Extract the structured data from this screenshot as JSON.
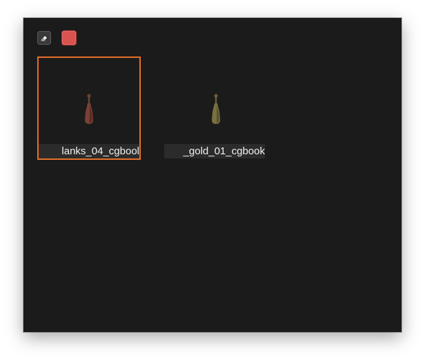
{
  "toolbar": {
    "eraser_icon": "eraser-icon",
    "swatch_color": "#d9534f"
  },
  "assets": [
    {
      "label": "lanks_04_cgbool",
      "selected": true,
      "thumb_color": "#7a3f35"
    },
    {
      "label": "_gold_01_cgbook",
      "selected": false,
      "thumb_color": "#7a7040"
    }
  ],
  "colors": {
    "window_bg": "#1b1b1b",
    "selection": "#e8702a",
    "label_bg": "#2b2b2b"
  }
}
